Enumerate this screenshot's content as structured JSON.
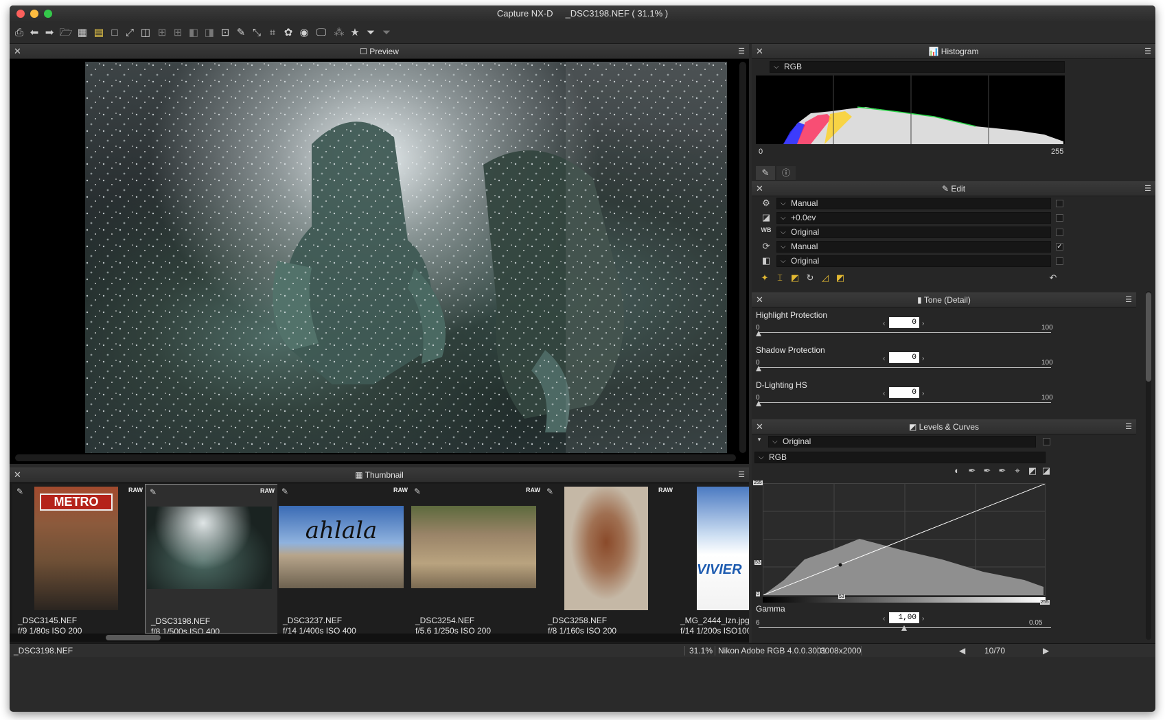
{
  "window": {
    "app": "Capture NX-D",
    "file_title": "_DSC3198.NEF ( 31.1% )"
  },
  "toolbar": {
    "icons": [
      "print-icon",
      "back-icon",
      "forward-icon",
      "open-folder-icon",
      "grid-view-icon",
      "filmstrip-view-icon",
      "single-view-icon",
      "fullscreen-icon",
      "compare-two-icon",
      "compare-grid-icon",
      "compare-four-icon",
      "compare-before-icon",
      "compare-after-icon",
      "loupe-icon",
      "brush-icon",
      "straighten-icon",
      "crop-icon",
      "dust-icon",
      "red-eye-icon",
      "display-icon",
      "auto-retouch-icon",
      "star-icon",
      "filter-icon",
      "filter-clear-icon"
    ]
  },
  "preview": {
    "title": "Preview"
  },
  "thumbnail": {
    "title": "Thumbnail",
    "items": [
      {
        "name": "_DSC3145.NEF",
        "exif": "f/9 1/80s ISO 200",
        "raw": "RAW"
      },
      {
        "name": "_DSC3198.NEF",
        "exif": "f/8 1/500s ISO 400",
        "raw": "RAW"
      },
      {
        "name": "_DSC3237.NEF",
        "exif": "f/14 1/400s ISO 400",
        "raw": "RAW"
      },
      {
        "name": "_DSC3254.NEF",
        "exif": "f/5.6 1/250s ISO 200",
        "raw": "RAW"
      },
      {
        "name": "_DSC3258.NEF",
        "exif": "f/8 1/160s ISO 200",
        "raw": "RAW"
      },
      {
        "name": "_MG_2444_lzn.jpg",
        "exif": "f/14 1/200s ISO100",
        "raw": ""
      }
    ]
  },
  "histogram": {
    "title": "Histogram",
    "channel": "RGB",
    "min": "0",
    "max": "255"
  },
  "edit": {
    "title": "Edit",
    "rows": [
      {
        "icon": "gear-icon",
        "value": "Manual",
        "checked": false
      },
      {
        "icon": "exposure-icon",
        "value": "+0.0ev",
        "checked": false
      },
      {
        "icon": "white-balance-icon",
        "value": "Original",
        "checked": false
      },
      {
        "icon": "picture-control-icon",
        "value": "Manual",
        "checked": true
      },
      {
        "icon": "tone-icon",
        "value": "Original",
        "checked": false
      }
    ]
  },
  "tone": {
    "title": "Tone (Detail)",
    "sliders": [
      {
        "label": "Highlight Protection",
        "value": "0",
        "min": "0",
        "max": "100",
        "level": 0
      },
      {
        "label": "Shadow Protection",
        "value": "0",
        "min": "0",
        "max": "100",
        "level": 0
      },
      {
        "label": "D-Lighting HS",
        "value": "0",
        "min": "0",
        "max": "100",
        "level": 0
      }
    ]
  },
  "levels": {
    "title": "Levels & Curves",
    "preset": "Original",
    "channel": "RGB",
    "tick_top": "255",
    "tick_mid": "53",
    "tick_bot": "0",
    "tick_right": "255",
    "gamma_label": "Gamma",
    "gamma_value": "1,00",
    "gamma_min": "6",
    "gamma_max": "0.05"
  },
  "status": {
    "file": "_DSC3198.NEF",
    "zoom": "31.1%",
    "profile": "Nikon Adobe RGB 4.0.0.3001",
    "size": "3008x2000",
    "position": "10/70"
  }
}
